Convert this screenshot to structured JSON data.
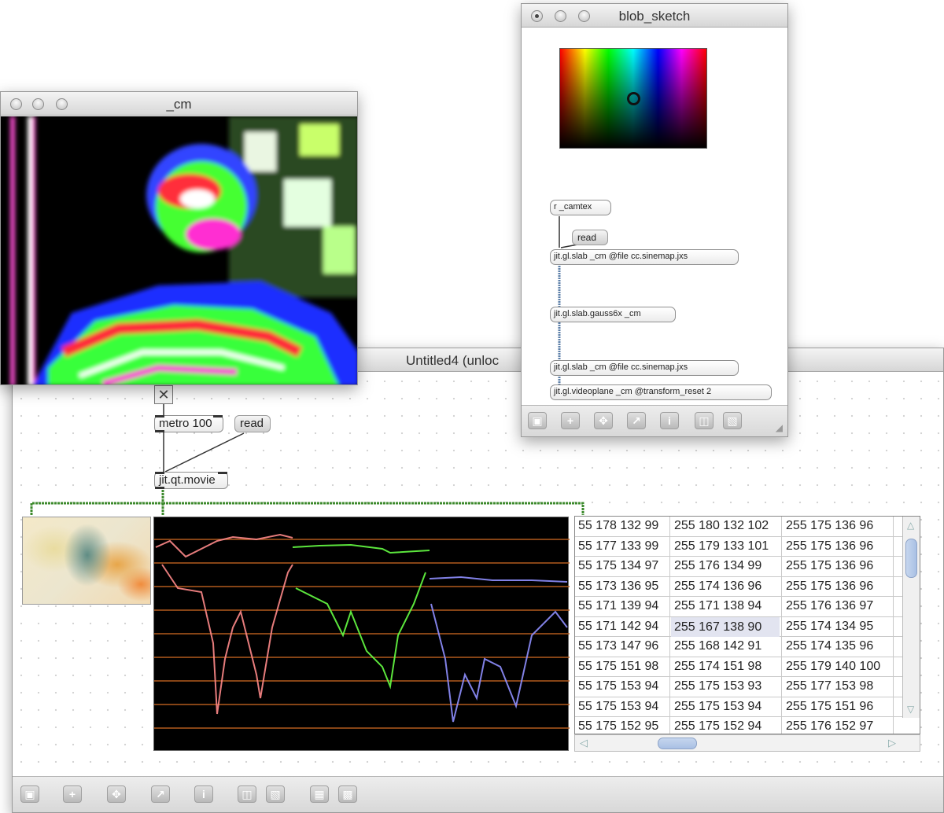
{
  "windows": {
    "cm": {
      "title": "_cm"
    },
    "blob": {
      "title": "blob_sketch"
    },
    "untitled": {
      "title": "Untitled4 (unloc"
    }
  },
  "patch": {
    "toggle_glyph": "✕",
    "metro_label": "metro 100",
    "read_label": "read",
    "movie_label": "jit.qt.movie"
  },
  "blob_patch": {
    "receive_label": "r _camtex",
    "read_label": "read",
    "slab1_label": "jit.gl.slab _cm @file cc.sinemap.jxs",
    "gauss_label": "jit.gl.slab.gauss6x _cm",
    "slab2_label": "jit.gl.slab _cm @file cc.sinemap.jxs",
    "videoplane_label": "jit.gl.videoplane _cm @transform_reset 2"
  },
  "toolbar_icons": [
    "lock-icon",
    "add-icon",
    "move-icon",
    "graph-icon",
    "info-icon",
    "window-icon",
    "layers-icon",
    "grid-icon",
    "snap-icon"
  ],
  "matrix": {
    "selected_row": 5,
    "selected_col": 1,
    "rows": [
      [
        "55 178 132 99",
        "255 180 132 102",
        "255 175 136 96"
      ],
      [
        "55 177 133 99",
        "255 179 133 101",
        "255 175 136 96"
      ],
      [
        "55 175 134 97",
        "255 176 134 99",
        "255 175 136 96"
      ],
      [
        "55 173 136 95",
        "255 174 136 96",
        "255 175 136 96"
      ],
      [
        "55 171 139 94",
        "255 171 138 94",
        "255 176 136 97"
      ],
      [
        "55 171 142 94",
        "255 167 138 90",
        "255 174 134 95"
      ],
      [
        "55 173 147 96",
        "255 168 142 91",
        "255 174 135 96"
      ],
      [
        "55 175 151 98",
        "255 174 151 98",
        "255 179 140 100"
      ],
      [
        "55 175 153 94",
        "255 175 153 93",
        "255 177 153 98"
      ],
      [
        "55 175 153 94",
        "255 175 153 94",
        "255 175 151 96"
      ],
      [
        "55 175 152 95",
        "255 175 152 94",
        "255 176 152 97"
      ]
    ]
  },
  "colors": {
    "patchcord_green": "#3c8a2c",
    "scope_red": "#ff8a8a",
    "scope_green": "#66ff44",
    "scope_blue": "#8f8fff",
    "scope_gridline": "#b25a1e"
  }
}
